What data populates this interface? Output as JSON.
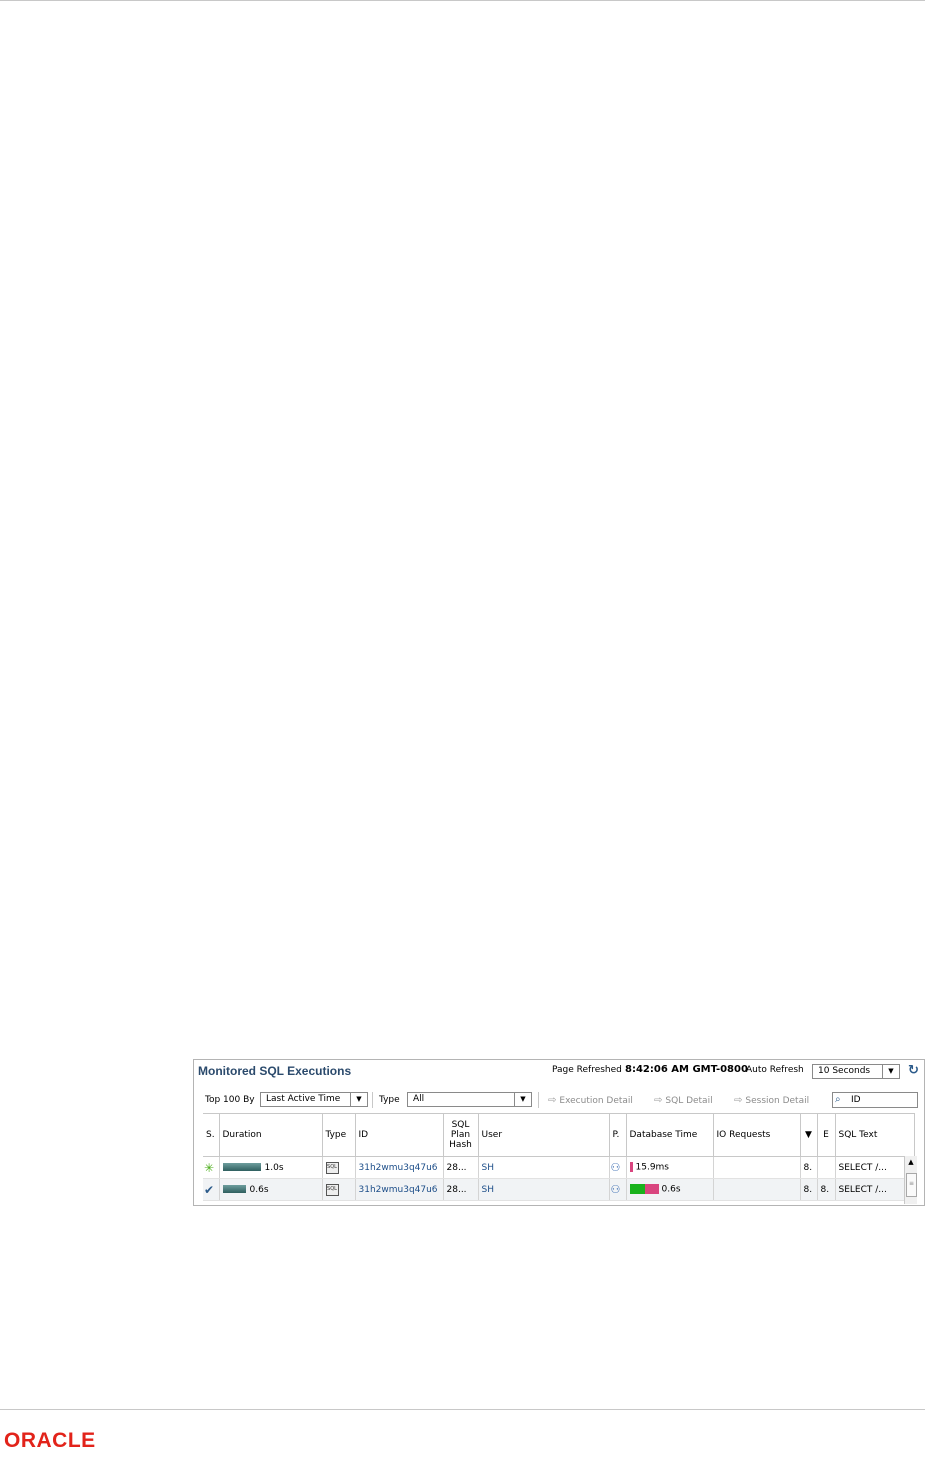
{
  "panel": {
    "title": "Monitored SQL Executions",
    "page_refreshed_label": "Page Refreshed",
    "page_refreshed_time": "8:42:06 AM GMT-0800",
    "auto_refresh_label": "Auto Refresh",
    "auto_refresh_value": "10 Seconds"
  },
  "toolbar": {
    "top_label": "Top 100 By",
    "top_value": "Last Active Time",
    "type_label": "Type",
    "type_value": "All",
    "execution_detail": "Execution Detail",
    "sql_detail": "SQL Detail",
    "session_detail": "Session Detail",
    "search_value": "ID"
  },
  "columns": {
    "status": "S.",
    "duration": "Duration",
    "type": "Type",
    "id": "ID",
    "plan_hash": "SQL Plan Hash",
    "user": "User",
    "parallel": "P.",
    "db_time": "Database Time",
    "io_requests": "IO Requests",
    "sort": "▼",
    "e": "E",
    "sql_text": "SQL Text"
  },
  "rows": [
    {
      "status_icon": "running-spinner-icon",
      "duration": "1.0s",
      "duration_fraction": 1.0,
      "type_icon": "sql-icon",
      "id": "31h2wmu3q47u6",
      "plan_hash": "28...",
      "user": "SH",
      "parallel_icon": "parallel-icon",
      "db_time": "15.9ms",
      "io_requests": "",
      "col_sort": "8.",
      "col_e": "",
      "sql_text": "SELECT /..."
    },
    {
      "status_icon": "done-check-icon",
      "duration": "0.6s",
      "duration_fraction": 0.6,
      "type_icon": "sql-icon",
      "id": "31h2wmu3q47u6",
      "plan_hash": "28...",
      "user": "SH",
      "parallel_icon": "parallel-icon",
      "db_time": "0.6s",
      "io_requests": "",
      "col_sort": "8.",
      "col_e": "8.",
      "sql_text": "SELECT /..."
    }
  ],
  "footer": {
    "logo_text": "ORACLE"
  },
  "colors": {
    "title": "#2b4a6c",
    "link": "#1d4e89",
    "logo": "#e2231a",
    "db_cpu": "#19b21c",
    "db_io": "#d9457f"
  }
}
